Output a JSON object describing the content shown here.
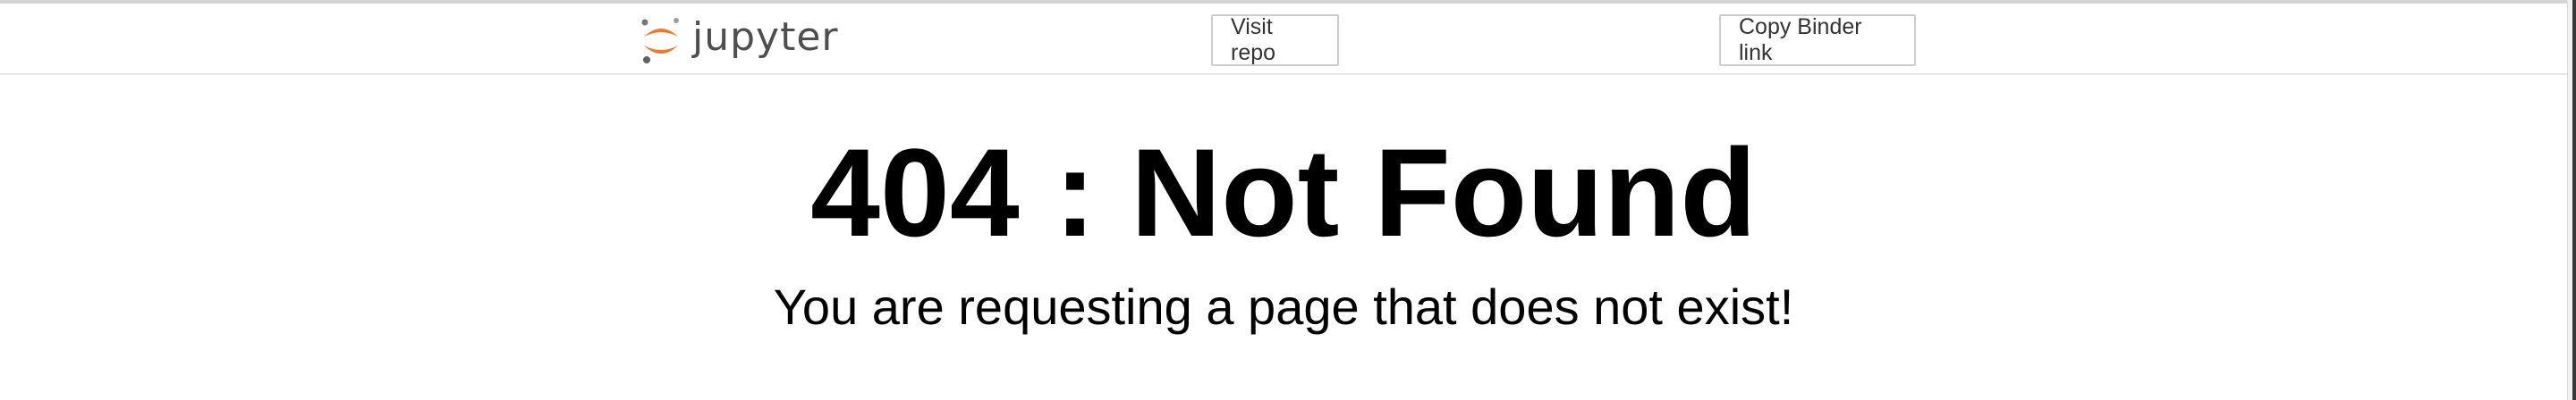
{
  "header": {
    "logo_text": "jupyter",
    "visit_repo_label": "Visit repo",
    "copy_binder_label": "Copy Binder link"
  },
  "main": {
    "title": "404 : Not Found",
    "message": "You are requesting a page that does not exist!"
  },
  "colors": {
    "jupyter_orange": "#f37726",
    "jupyter_grey": "#4e4e4e"
  },
  "icons": {
    "logo": "jupyter-logo-icon"
  }
}
